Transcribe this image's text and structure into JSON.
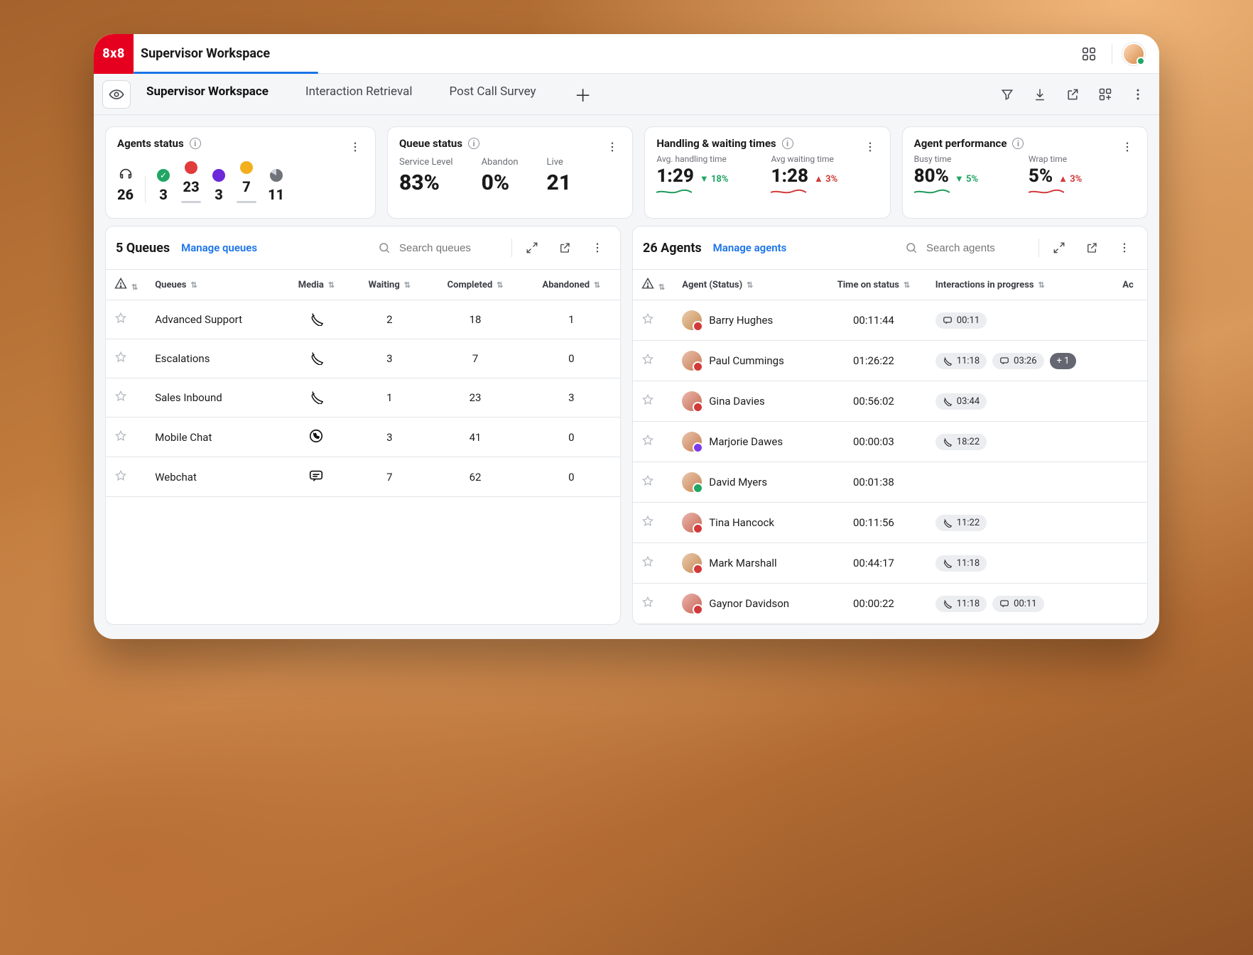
{
  "app": {
    "logo": "8x8",
    "title": "Supervisor Workspace"
  },
  "tabs": [
    {
      "label": "Supervisor Workspace",
      "active": true
    },
    {
      "label": "Interaction Retrieval",
      "active": false
    },
    {
      "label": "Post Call Survey",
      "active": false
    }
  ],
  "cards": {
    "agents_status": {
      "title": "Agents status",
      "total": "26",
      "available": "3",
      "busy": "23",
      "away": "3",
      "wrap": "7",
      "offline": "11"
    },
    "queue_status": {
      "title": "Queue status",
      "service_level": {
        "label": "Service Level",
        "value": "83%"
      },
      "abandon": {
        "label": "Abandon",
        "value": "0%"
      },
      "live": {
        "label": "Live",
        "value": "21"
      }
    },
    "handling_times": {
      "title": "Handling & waiting times",
      "avg_handle": {
        "label": "Avg. handling time",
        "value": "1:29",
        "delta": "18%",
        "dir": "down"
      },
      "avg_wait": {
        "label": "Avg waiting time",
        "value": "1:28",
        "delta": "3%",
        "dir": "up"
      }
    },
    "agent_perf": {
      "title": "Agent performance",
      "busy": {
        "label": "Busy time",
        "value": "80%",
        "delta": "5%",
        "dir": "down"
      },
      "wrap": {
        "label": "Wrap time",
        "value": "5%",
        "delta": "3%",
        "dir": "up"
      }
    }
  },
  "queues_panel": {
    "count_label": "5 Queues",
    "manage": "Manage queues",
    "search_placeholder": "Search queues",
    "columns": {
      "alert": "",
      "queues": "Queues",
      "media": "Media",
      "waiting": "Waiting",
      "completed": "Completed",
      "abandoned": "Abandoned"
    },
    "rows": [
      {
        "name": "Advanced Support",
        "media": "phone",
        "waiting": "2",
        "completed": "18",
        "abandoned": "1"
      },
      {
        "name": "Escalations",
        "media": "phone",
        "waiting": "3",
        "completed": "7",
        "abandoned": "0"
      },
      {
        "name": "Sales Inbound",
        "media": "phone",
        "waiting": "1",
        "completed": "23",
        "abandoned": "3"
      },
      {
        "name": "Mobile Chat",
        "media": "whatsapp",
        "waiting": "3",
        "completed": "41",
        "abandoned": "0"
      },
      {
        "name": "Webchat",
        "media": "chat",
        "waiting": "7",
        "completed": "62",
        "abandoned": "0"
      }
    ]
  },
  "agents_panel": {
    "count_label": "26 Agents",
    "manage": "Manage agents",
    "search_placeholder": "Search agents",
    "columns": {
      "alert": "",
      "agent": "Agent (Status)",
      "time": "Time on status",
      "interactions": "Interactions in progress",
      "extra": "Ac"
    },
    "rows": [
      {
        "name": "Barry Hughes",
        "status": "busy",
        "avhue": 30,
        "time": "00:11:44",
        "chips": [
          {
            "type": "chat",
            "text": "00:11"
          }
        ]
      },
      {
        "name": "Paul Cummings",
        "status": "busy",
        "avhue": 20,
        "time": "01:26:22",
        "chips": [
          {
            "type": "phone",
            "text": "11:18"
          },
          {
            "type": "chat",
            "text": "03:26"
          },
          {
            "type": "plus",
            "text": "+ 1"
          }
        ]
      },
      {
        "name": "Gina Davies",
        "status": "busy",
        "avhue": 12,
        "time": "00:56:02",
        "chips": [
          {
            "type": "phone",
            "text": "03:44"
          }
        ]
      },
      {
        "name": "Marjorie Dawes",
        "status": "idle",
        "avhue": 22,
        "time": "00:00:03",
        "chips": [
          {
            "type": "phone",
            "text": "18:22"
          }
        ]
      },
      {
        "name": "David Myers",
        "status": "ok",
        "avhue": 25,
        "time": "00:01:38",
        "chips": []
      },
      {
        "name": "Tina Hancock",
        "status": "busy",
        "avhue": 10,
        "time": "00:11:56",
        "chips": [
          {
            "type": "phone",
            "text": "11:22"
          }
        ]
      },
      {
        "name": "Mark Marshall",
        "status": "busy",
        "avhue": 28,
        "time": "00:44:17",
        "chips": [
          {
            "type": "phone",
            "text": "11:18"
          }
        ]
      },
      {
        "name": "Gaynor Davidson",
        "status": "busy",
        "avhue": 8,
        "time": "00:00:22",
        "chips": [
          {
            "type": "phone",
            "text": "11:18"
          },
          {
            "type": "chat",
            "text": "00:11"
          }
        ]
      }
    ]
  }
}
